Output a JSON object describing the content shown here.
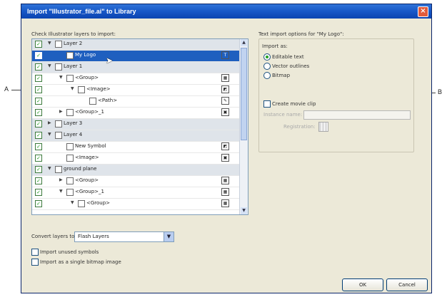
{
  "callouts": {
    "left": "A",
    "right": "B"
  },
  "dialog": {
    "title": "Import \"Illustrator_file.ai\" to Library",
    "close_glyph": "×",
    "check_layers_label": "Check Illustrator layers to import:",
    "text_options_label": "Text import options for \"My Logo\":",
    "import_as_label": "Import as:",
    "options": {
      "editable_text": "Editable text",
      "vector_outlines": "Vector outlines",
      "bitmap": "Bitmap",
      "create_movie_clip": "Create movie clip",
      "instance_name": "Instance name:",
      "registration": "Registration:"
    },
    "convert_layers_label": "Convert layers to:",
    "convert_layers_value": "Flash Layers",
    "import_unused_symbols": "Import unused symbols",
    "import_single_bitmap": "Import as a single bitmap image",
    "ok": "OK",
    "cancel": "Cancel"
  },
  "tree_rows": [
    {
      "label": "Layer 2",
      "depth": 0,
      "kind": "layer",
      "twisty": "▼",
      "checked": true,
      "icon": ""
    },
    {
      "label": "My Logo",
      "depth": 1,
      "kind": "item",
      "twisty": "",
      "checked": true,
      "icon": "T",
      "selected": true
    },
    {
      "label": "Layer 1",
      "depth": 0,
      "kind": "layer",
      "twisty": "▼",
      "checked": true,
      "icon": ""
    },
    {
      "label": "<Group>",
      "depth": 1,
      "kind": "item",
      "twisty": "▼",
      "checked": true,
      "icon": "▦"
    },
    {
      "label": "<Image>",
      "depth": 2,
      "kind": "item",
      "twisty": "▼",
      "checked": true,
      "icon": "◩"
    },
    {
      "label": "<Path>",
      "depth": 3,
      "kind": "item",
      "twisty": "",
      "checked": true,
      "icon": "✎"
    },
    {
      "label": "<Group>_1",
      "depth": 1,
      "kind": "item",
      "twisty": "▶",
      "checked": true,
      "icon": "▣"
    },
    {
      "label": "Layer 3",
      "depth": 0,
      "kind": "layer",
      "twisty": "▶",
      "checked": true,
      "icon": ""
    },
    {
      "label": "Layer 4",
      "depth": 0,
      "kind": "layer",
      "twisty": "▼",
      "checked": true,
      "icon": ""
    },
    {
      "label": "New Symbol",
      "depth": 1,
      "kind": "item",
      "twisty": "",
      "checked": true,
      "icon": "◩"
    },
    {
      "label": "<Image>",
      "depth": 1,
      "kind": "item",
      "twisty": "",
      "checked": true,
      "icon": "▣"
    },
    {
      "label": "ground plane",
      "depth": 0,
      "kind": "layer",
      "twisty": "▼",
      "checked": true,
      "icon": ""
    },
    {
      "label": "<Group>",
      "depth": 1,
      "kind": "item",
      "twisty": "▶",
      "checked": true,
      "icon": "▦"
    },
    {
      "label": "<Group>_1",
      "depth": 1,
      "kind": "item",
      "twisty": "▼",
      "checked": true,
      "icon": "▦"
    },
    {
      "label": "<Group>",
      "depth": 2,
      "kind": "item",
      "twisty": "▼",
      "checked": true,
      "icon": "▦"
    }
  ]
}
